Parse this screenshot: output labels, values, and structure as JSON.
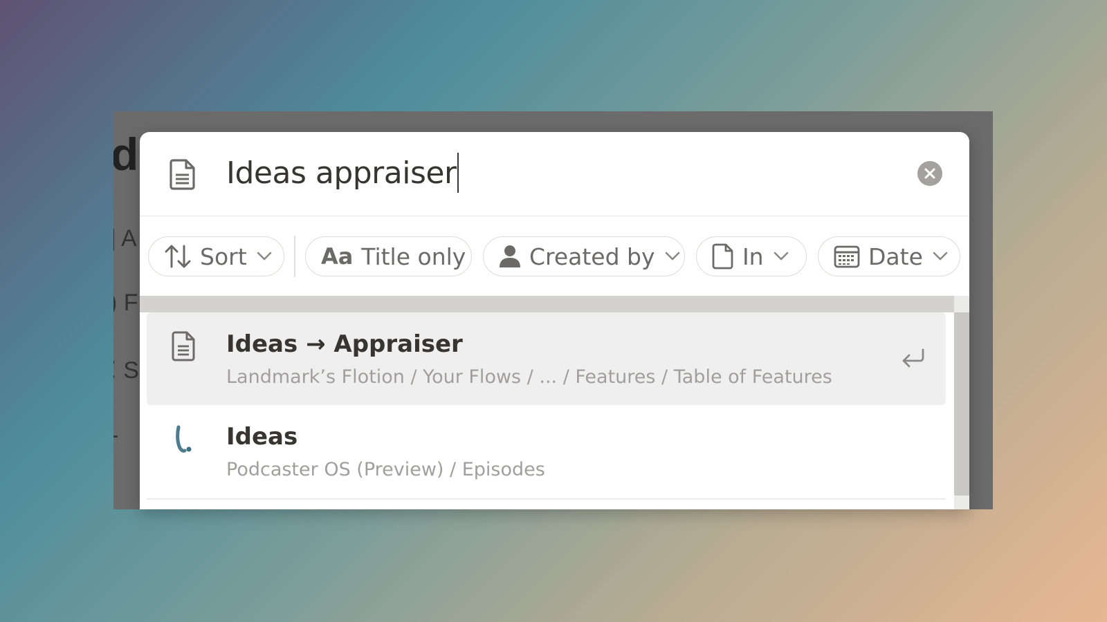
{
  "background_app": {
    "heading_fragment": "d",
    "sidebar_fragments": [
      "A",
      "F",
      "S",
      "-"
    ]
  },
  "search": {
    "query": "Ideas appraiser",
    "icon": "page-icon",
    "clear_icon": "close-circle-icon"
  },
  "filters": [
    {
      "label": "Sort",
      "icon": "sort-arrows-icon"
    },
    {
      "label": "Title only",
      "icon": "text-aa-icon"
    },
    {
      "label": "Created by",
      "icon": "person-icon"
    },
    {
      "label": "In",
      "icon": "page-icon"
    },
    {
      "label": "Date",
      "icon": "calendar-icon"
    }
  ],
  "results": [
    {
      "title": "Ideas → Appraiser",
      "path": "Landmark’s Flotion / Your Flows / ... / Features / Table of Features",
      "icon": "page-icon",
      "selected": true,
      "action_icon": "enter-return-icon"
    },
    {
      "title": "Ideas",
      "path": "Podcaster OS (Preview) / Episodes",
      "icon": "brand-logo-icon",
      "selected": false
    }
  ],
  "colors": {
    "text_primary": "#37352f",
    "text_secondary": "#a09f9b",
    "selected_row": "#efefef",
    "chip_border": "#dcdbd8"
  }
}
